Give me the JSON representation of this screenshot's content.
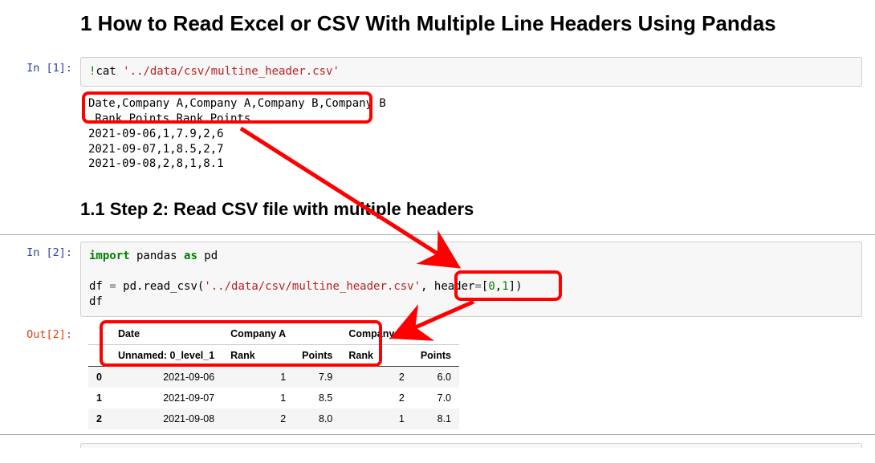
{
  "heading1": "1  How to Read Excel or CSV With Multiple Line Headers Using Pandas",
  "heading2": "1.1  Step 2: Read CSV file with multiple headers",
  "cell1": {
    "prompt": "In [1]:",
    "magic": "!",
    "cmd": "cat ",
    "path": "'../data/csv/multine_header.csv'",
    "out1": "Date,Company A,Company A,Company B,Company B",
    "out2": ",Rank,Points,Rank,Points",
    "out3": "2021-09-06,1,7.9,2,6",
    "out4": "2021-09-07,1,8.5,2,7",
    "out5": "2021-09-08,2,8,1,8.1"
  },
  "cell2": {
    "prompt": "In [2]:",
    "kw_import": "import",
    "mod": " pandas ",
    "kw_as": "as",
    "alias": " pd",
    "line2_a": "df ",
    "op_eq": "=",
    "line2_b": " pd.read_csv(",
    "str_path": "'../data/csv/multine_header.csv'",
    "comma": ", header",
    "op_eq2": "=",
    "brk_open": "[",
    "n0": "0",
    "ncomma": ",",
    "n1": "1",
    "brk_close": "])",
    "line3": "df"
  },
  "out2_label": "Out[2]:",
  "table": {
    "lvl0": [
      "",
      "Date",
      "Company A",
      "",
      "Company B",
      ""
    ],
    "lvl1": [
      "",
      "Unnamed: 0_level_1",
      "Rank",
      "Points",
      "Rank",
      "Points"
    ],
    "rows": [
      {
        "idx": "0",
        "date": "2021-09-06",
        "a_rank": "1",
        "a_pts": "7.9",
        "b_rank": "2",
        "b_pts": "6.0"
      },
      {
        "idx": "1",
        "date": "2021-09-07",
        "a_rank": "1",
        "a_pts": "8.5",
        "b_rank": "2",
        "b_pts": "7.0"
      },
      {
        "idx": "2",
        "date": "2021-09-08",
        "a_rank": "2",
        "a_pts": "8.0",
        "b_rank": "1",
        "b_pts": "8.1"
      }
    ]
  },
  "annotations": {
    "box1": {
      "top": 0,
      "left": 0
    },
    "box2": {
      "top": 0,
      "left": 0
    },
    "box3": {
      "top": 0,
      "left": 0
    }
  }
}
